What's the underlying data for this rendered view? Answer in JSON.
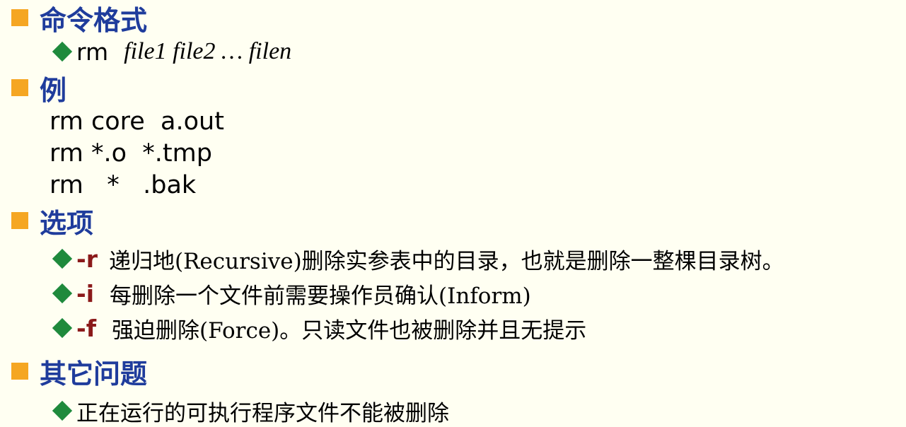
{
  "sections": {
    "format": {
      "title": "命令格式",
      "command": "rm",
      "args": "file1  file2  …  filen"
    },
    "example": {
      "title": "例",
      "lines": [
        "rm core  a.out",
        "rm *.o  *.tmp",
        "rm   *   .bak"
      ]
    },
    "options": {
      "title": "选项",
      "items": [
        {
          "flag": "-r",
          "desc": "递归地(Recursive)删除实参表中的目录，也就是删除一整棵目录树。"
        },
        {
          "flag": "-i",
          "desc": "每删除一个文件前需要操作员确认(Inform)"
        },
        {
          "flag": "-f",
          "desc": "强迫删除(Force)。只读文件也被删除并且无提示"
        }
      ]
    },
    "other": {
      "title": "其它问题",
      "items": [
        "正在运行的可执行程序文件不能被删除"
      ]
    }
  },
  "colors": {
    "heading": "#1f3c9c",
    "square_bullet": "#f5a623",
    "diamond_bullet": "#1f8a3c",
    "flag": "#8b1a1a",
    "background": "#fffff2"
  }
}
